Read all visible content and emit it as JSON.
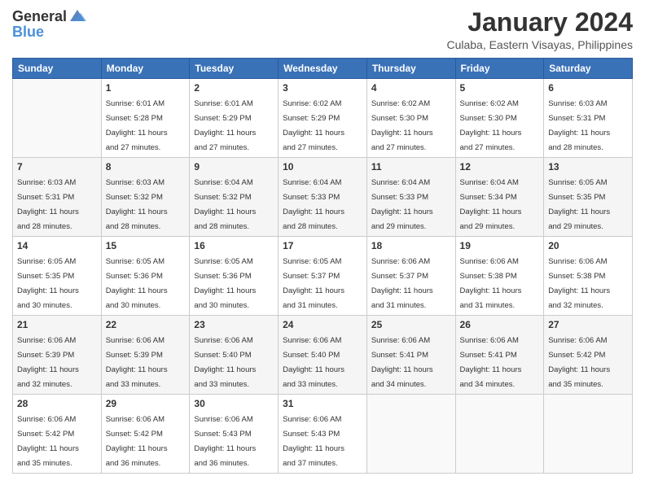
{
  "header": {
    "logo_general": "General",
    "logo_blue": "Blue",
    "month_year": "January 2024",
    "location": "Culaba, Eastern Visayas, Philippines"
  },
  "weekdays": [
    "Sunday",
    "Monday",
    "Tuesday",
    "Wednesday",
    "Thursday",
    "Friday",
    "Saturday"
  ],
  "weeks": [
    [
      {
        "day": "",
        "info": ""
      },
      {
        "day": "1",
        "info": "Sunrise: 6:01 AM\nSunset: 5:28 PM\nDaylight: 11 hours\nand 27 minutes."
      },
      {
        "day": "2",
        "info": "Sunrise: 6:01 AM\nSunset: 5:29 PM\nDaylight: 11 hours\nand 27 minutes."
      },
      {
        "day": "3",
        "info": "Sunrise: 6:02 AM\nSunset: 5:29 PM\nDaylight: 11 hours\nand 27 minutes."
      },
      {
        "day": "4",
        "info": "Sunrise: 6:02 AM\nSunset: 5:30 PM\nDaylight: 11 hours\nand 27 minutes."
      },
      {
        "day": "5",
        "info": "Sunrise: 6:02 AM\nSunset: 5:30 PM\nDaylight: 11 hours\nand 27 minutes."
      },
      {
        "day": "6",
        "info": "Sunrise: 6:03 AM\nSunset: 5:31 PM\nDaylight: 11 hours\nand 28 minutes."
      }
    ],
    [
      {
        "day": "7",
        "info": "Sunrise: 6:03 AM\nSunset: 5:31 PM\nDaylight: 11 hours\nand 28 minutes."
      },
      {
        "day": "8",
        "info": "Sunrise: 6:03 AM\nSunset: 5:32 PM\nDaylight: 11 hours\nand 28 minutes."
      },
      {
        "day": "9",
        "info": "Sunrise: 6:04 AM\nSunset: 5:32 PM\nDaylight: 11 hours\nand 28 minutes."
      },
      {
        "day": "10",
        "info": "Sunrise: 6:04 AM\nSunset: 5:33 PM\nDaylight: 11 hours\nand 28 minutes."
      },
      {
        "day": "11",
        "info": "Sunrise: 6:04 AM\nSunset: 5:33 PM\nDaylight: 11 hours\nand 29 minutes."
      },
      {
        "day": "12",
        "info": "Sunrise: 6:04 AM\nSunset: 5:34 PM\nDaylight: 11 hours\nand 29 minutes."
      },
      {
        "day": "13",
        "info": "Sunrise: 6:05 AM\nSunset: 5:35 PM\nDaylight: 11 hours\nand 29 minutes."
      }
    ],
    [
      {
        "day": "14",
        "info": "Sunrise: 6:05 AM\nSunset: 5:35 PM\nDaylight: 11 hours\nand 30 minutes."
      },
      {
        "day": "15",
        "info": "Sunrise: 6:05 AM\nSunset: 5:36 PM\nDaylight: 11 hours\nand 30 minutes."
      },
      {
        "day": "16",
        "info": "Sunrise: 6:05 AM\nSunset: 5:36 PM\nDaylight: 11 hours\nand 30 minutes."
      },
      {
        "day": "17",
        "info": "Sunrise: 6:05 AM\nSunset: 5:37 PM\nDaylight: 11 hours\nand 31 minutes."
      },
      {
        "day": "18",
        "info": "Sunrise: 6:06 AM\nSunset: 5:37 PM\nDaylight: 11 hours\nand 31 minutes."
      },
      {
        "day": "19",
        "info": "Sunrise: 6:06 AM\nSunset: 5:38 PM\nDaylight: 11 hours\nand 31 minutes."
      },
      {
        "day": "20",
        "info": "Sunrise: 6:06 AM\nSunset: 5:38 PM\nDaylight: 11 hours\nand 32 minutes."
      }
    ],
    [
      {
        "day": "21",
        "info": "Sunrise: 6:06 AM\nSunset: 5:39 PM\nDaylight: 11 hours\nand 32 minutes."
      },
      {
        "day": "22",
        "info": "Sunrise: 6:06 AM\nSunset: 5:39 PM\nDaylight: 11 hours\nand 33 minutes."
      },
      {
        "day": "23",
        "info": "Sunrise: 6:06 AM\nSunset: 5:40 PM\nDaylight: 11 hours\nand 33 minutes."
      },
      {
        "day": "24",
        "info": "Sunrise: 6:06 AM\nSunset: 5:40 PM\nDaylight: 11 hours\nand 33 minutes."
      },
      {
        "day": "25",
        "info": "Sunrise: 6:06 AM\nSunset: 5:41 PM\nDaylight: 11 hours\nand 34 minutes."
      },
      {
        "day": "26",
        "info": "Sunrise: 6:06 AM\nSunset: 5:41 PM\nDaylight: 11 hours\nand 34 minutes."
      },
      {
        "day": "27",
        "info": "Sunrise: 6:06 AM\nSunset: 5:42 PM\nDaylight: 11 hours\nand 35 minutes."
      }
    ],
    [
      {
        "day": "28",
        "info": "Sunrise: 6:06 AM\nSunset: 5:42 PM\nDaylight: 11 hours\nand 35 minutes."
      },
      {
        "day": "29",
        "info": "Sunrise: 6:06 AM\nSunset: 5:42 PM\nDaylight: 11 hours\nand 36 minutes."
      },
      {
        "day": "30",
        "info": "Sunrise: 6:06 AM\nSunset: 5:43 PM\nDaylight: 11 hours\nand 36 minutes."
      },
      {
        "day": "31",
        "info": "Sunrise: 6:06 AM\nSunset: 5:43 PM\nDaylight: 11 hours\nand 37 minutes."
      },
      {
        "day": "",
        "info": ""
      },
      {
        "day": "",
        "info": ""
      },
      {
        "day": "",
        "info": ""
      }
    ]
  ]
}
